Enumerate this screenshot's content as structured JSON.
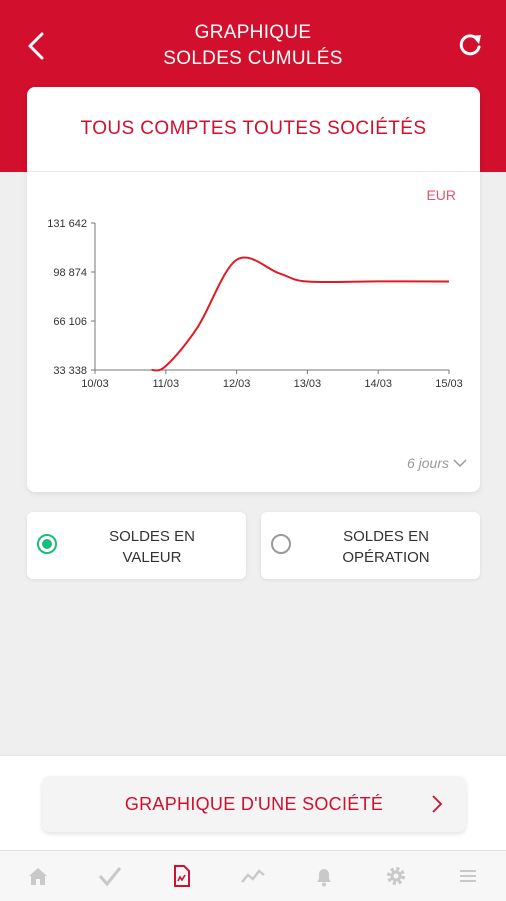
{
  "header": {
    "title_line1": "GRAPHIQUE",
    "title_line2": "SOLDES CUMULÉS",
    "back_icon": "chevron-left-icon",
    "refresh_icon": "refresh-icon",
    "color": "#d20f2c"
  },
  "card": {
    "title": "TOUS COMPTES TOUTES SOCIÉTÉS",
    "currency": "EUR",
    "period": "6 jours"
  },
  "chart_data": {
    "type": "line",
    "x": [
      "10/03",
      "11/03",
      "12/03",
      "13/03",
      "14/03",
      "15/03"
    ],
    "ylim": [
      33338,
      131642
    ],
    "yticks": [
      33338,
      66106,
      98874,
      131642
    ],
    "ytick_labels": [
      "33 338",
      "66 106",
      "98 874",
      "131 642"
    ],
    "series": [
      {
        "points": [
          [
            "10/03",
            33338
          ],
          [
            "10/12 11/03",
            33338
          ],
          [
            "11/03",
            36000
          ],
          [
            "11/03+",
            55000
          ],
          [
            "12/03",
            107000
          ],
          [
            "12/03+",
            103000
          ],
          [
            "13/03",
            92500
          ],
          [
            "14/03",
            92600
          ],
          [
            "15/03",
            92500
          ]
        ],
        "color": "#e21a23"
      }
    ],
    "grid": false,
    "unit": "EUR"
  },
  "radios": [
    {
      "line1": "SOLDES EN",
      "line2": "VALEUR",
      "selected": true
    },
    {
      "line1": "SOLDES EN",
      "line2": "OPÉRATION",
      "selected": false
    }
  ],
  "company_button": {
    "label": "GRAPHIQUE D'UNE SOCIÉTÉ"
  },
  "tabs": [
    "home-icon",
    "check-icon",
    "document-icon",
    "trend-icon",
    "bell-icon",
    "gear-icon",
    "menu-icon"
  ]
}
